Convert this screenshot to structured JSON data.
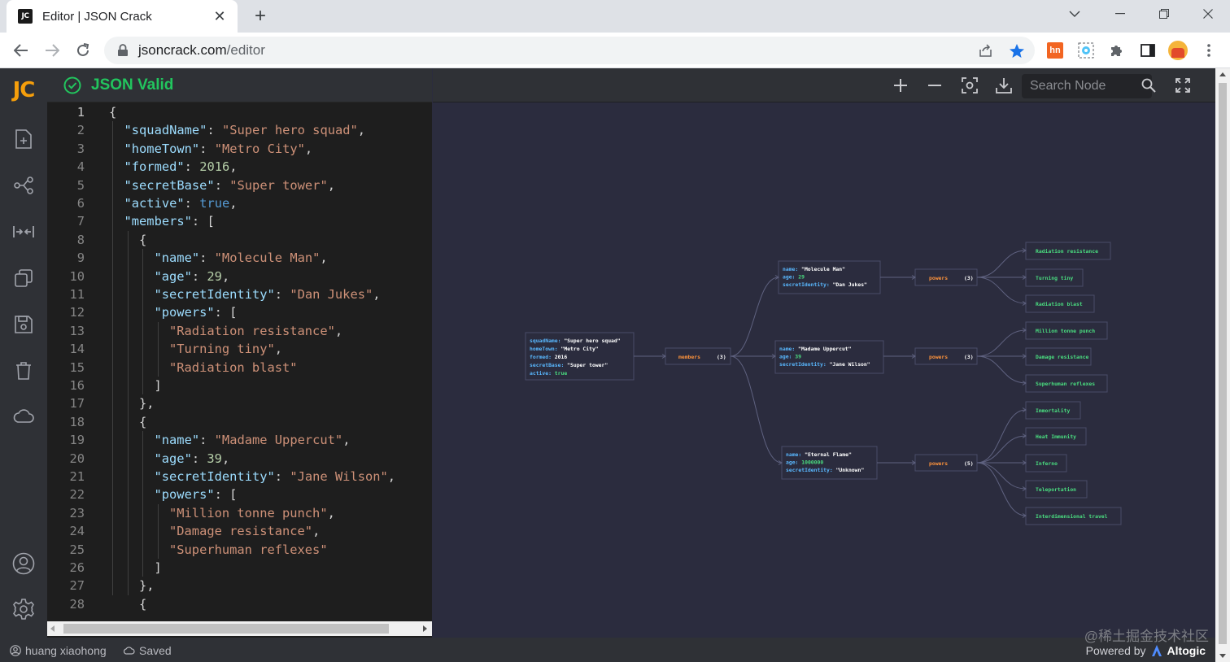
{
  "browser": {
    "tab_title": "Editor | JSON Crack",
    "tab_favicon": "JC",
    "url_domain": "jsoncrack.com",
    "url_path": "/editor"
  },
  "sidebar": {
    "logo": "JC"
  },
  "editor": {
    "status": "JSON Valid",
    "lines": [
      {
        "n": "1",
        "indent": 0,
        "html": "<span class='p'>{</span>"
      },
      {
        "n": "2",
        "indent": 1,
        "html": "<span class='k'>\"squadName\"</span><span class='p'>: </span><span class='s'>\"Super hero squad\"</span><span class='p'>,</span>"
      },
      {
        "n": "3",
        "indent": 1,
        "html": "<span class='k'>\"homeTown\"</span><span class='p'>: </span><span class='s'>\"Metro City\"</span><span class='p'>,</span>"
      },
      {
        "n": "4",
        "indent": 1,
        "html": "<span class='k'>\"formed\"</span><span class='p'>: </span><span class='n'>2016</span><span class='p'>,</span>"
      },
      {
        "n": "5",
        "indent": 1,
        "html": "<span class='k'>\"secretBase\"</span><span class='p'>: </span><span class='s'>\"Super tower\"</span><span class='p'>,</span>"
      },
      {
        "n": "6",
        "indent": 1,
        "html": "<span class='k'>\"active\"</span><span class='p'>: </span><span class='b'>true</span><span class='p'>,</span>"
      },
      {
        "n": "7",
        "indent": 1,
        "html": "<span class='k'>\"members\"</span><span class='p'>: [</span>"
      },
      {
        "n": "8",
        "indent": 2,
        "html": "<span class='p'>{</span>"
      },
      {
        "n": "9",
        "indent": 3,
        "html": "<span class='k'>\"name\"</span><span class='p'>: </span><span class='s'>\"Molecule Man\"</span><span class='p'>,</span>"
      },
      {
        "n": "10",
        "indent": 3,
        "html": "<span class='k'>\"age\"</span><span class='p'>: </span><span class='n'>29</span><span class='p'>,</span>"
      },
      {
        "n": "11",
        "indent": 3,
        "html": "<span class='k'>\"secretIdentity\"</span><span class='p'>: </span><span class='s'>\"Dan Jukes\"</span><span class='p'>,</span>"
      },
      {
        "n": "12",
        "indent": 3,
        "html": "<span class='k'>\"powers\"</span><span class='p'>: [</span>"
      },
      {
        "n": "13",
        "indent": 4,
        "html": "<span class='s'>\"Radiation resistance\"</span><span class='p'>,</span>"
      },
      {
        "n": "14",
        "indent": 4,
        "html": "<span class='s'>\"Turning tiny\"</span><span class='p'>,</span>"
      },
      {
        "n": "15",
        "indent": 4,
        "html": "<span class='s'>\"Radiation blast\"</span>"
      },
      {
        "n": "16",
        "indent": 3,
        "html": "<span class='p'>]</span>"
      },
      {
        "n": "17",
        "indent": 2,
        "html": "<span class='p'>},</span>"
      },
      {
        "n": "18",
        "indent": 2,
        "html": "<span class='p'>{</span>"
      },
      {
        "n": "19",
        "indent": 3,
        "html": "<span class='k'>\"name\"</span><span class='p'>: </span><span class='s'>\"Madame Uppercut\"</span><span class='p'>,</span>"
      },
      {
        "n": "20",
        "indent": 3,
        "html": "<span class='k'>\"age\"</span><span class='p'>: </span><span class='n'>39</span><span class='p'>,</span>"
      },
      {
        "n": "21",
        "indent": 3,
        "html": "<span class='k'>\"secretIdentity\"</span><span class='p'>: </span><span class='s'>\"Jane Wilson\"</span><span class='p'>,</span>"
      },
      {
        "n": "22",
        "indent": 3,
        "html": "<span class='k'>\"powers\"</span><span class='p'>: [</span>"
      },
      {
        "n": "23",
        "indent": 4,
        "html": "<span class='s'>\"Million tonne punch\"</span><span class='p'>,</span>"
      },
      {
        "n": "24",
        "indent": 4,
        "html": "<span class='s'>\"Damage resistance\"</span><span class='p'>,</span>"
      },
      {
        "n": "25",
        "indent": 4,
        "html": "<span class='s'>\"Superhuman reflexes\"</span>"
      },
      {
        "n": "26",
        "indent": 3,
        "html": "<span class='p'>]</span>"
      },
      {
        "n": "27",
        "indent": 2,
        "html": "<span class='p'>},</span>"
      },
      {
        "n": "28",
        "indent": 2,
        "html": "<span class='p'>{</span>"
      }
    ]
  },
  "graph": {
    "search_placeholder": "Search Node",
    "root": {
      "rows": [
        {
          "key": "squadName",
          "value": "\"Super hero squad\""
        },
        {
          "key": "homeTown",
          "value": "\"Metro City\""
        },
        {
          "key": "formed",
          "value": "2016"
        },
        {
          "key": "secretBase",
          "value": "\"Super tower\""
        },
        {
          "key": "active",
          "value": "true"
        }
      ]
    },
    "members_label": "members",
    "members_count": "(3)",
    "members": [
      {
        "name": "\"Molecule Man\"",
        "age": "29",
        "secretIdentity": "\"Dan Jukes\"",
        "powers_label": "powers",
        "powers_count": "(3)",
        "powers": [
          "Radiation resistance",
          "Turning tiny",
          "Radiation blast"
        ]
      },
      {
        "name": "\"Madame Uppercut\"",
        "age": "39",
        "secretIdentity": "\"Jane Wilson\"",
        "powers_label": "powers",
        "powers_count": "(3)",
        "powers": [
          "Million tonne punch",
          "Damage resistance",
          "Superhuman reflexes"
        ]
      },
      {
        "name": "\"Eternal Flame\"",
        "age": "1000000",
        "secretIdentity": "\"Unknown\"",
        "powers_label": "powers",
        "powers_count": "(5)",
        "powers": [
          "Immortality",
          "Heat Immunity",
          "Inferno",
          "Teleportation",
          "Interdimensional travel"
        ]
      }
    ]
  },
  "footer": {
    "user": "huang xiaohong",
    "saved": "Saved",
    "powered_by": "Powered by",
    "brand": "Altogic",
    "watermark": "@稀土掘金技术社区"
  },
  "colors": {
    "valid": "#22c55e",
    "json_key": "#9cdcfe",
    "json_string": "#ce9178",
    "json_number": "#b5cea8",
    "json_bool": "#569cd6",
    "node_key": "#59b8ff",
    "node_array": "#fb923c",
    "node_value": "#4ade80",
    "logo": "#f59e0b"
  }
}
